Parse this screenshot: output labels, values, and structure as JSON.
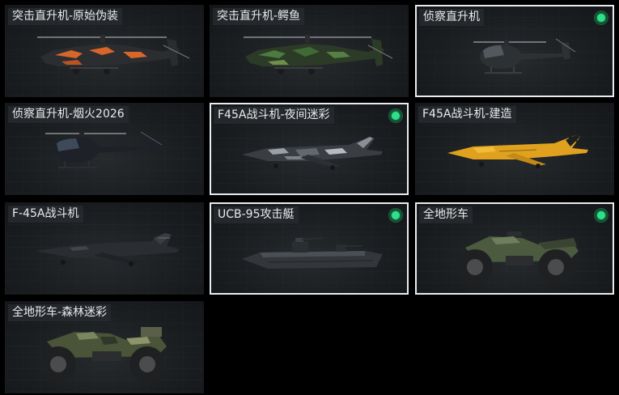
{
  "vehicles": [
    {
      "name": "突击直升机-原始伪装",
      "selected": false,
      "owned": false,
      "icon": "attack-helicopter-orange-camo-icon"
    },
    {
      "name": "突击直升机-鳄鱼",
      "selected": false,
      "owned": false,
      "icon": "attack-helicopter-green-camo-icon"
    },
    {
      "name": "侦察直升机",
      "selected": true,
      "owned": true,
      "icon": "scout-helicopter-icon"
    },
    {
      "name": "侦察直升机-烟火2026",
      "selected": false,
      "owned": false,
      "icon": "scout-helicopter-dark-icon"
    },
    {
      "name": "F45A战斗机-夜间迷彩",
      "selected": true,
      "owned": true,
      "icon": "jet-night-camo-icon"
    },
    {
      "name": "F45A战斗机-建造",
      "selected": false,
      "owned": false,
      "icon": "jet-construction-icon"
    },
    {
      "name": "F-45A战斗机",
      "selected": false,
      "owned": false,
      "icon": "stealth-fighter-icon"
    },
    {
      "name": "UCB-95攻击艇",
      "selected": true,
      "owned": true,
      "icon": "attack-boat-icon"
    },
    {
      "name": "全地形车",
      "selected": true,
      "owned": true,
      "icon": "atv-icon"
    },
    {
      "name": "全地形车-森林迷彩",
      "selected": false,
      "owned": false,
      "icon": "atv-forest-camo-icon"
    }
  ],
  "colors": {
    "background": "#000000",
    "card": "#1d2023",
    "selected_border": "#e8ecee",
    "owned_dot": "#2ee08a",
    "orange_camo": "#d8652a",
    "green_camo": "#3f6a35",
    "construction_yellow": "#e0a21e"
  }
}
